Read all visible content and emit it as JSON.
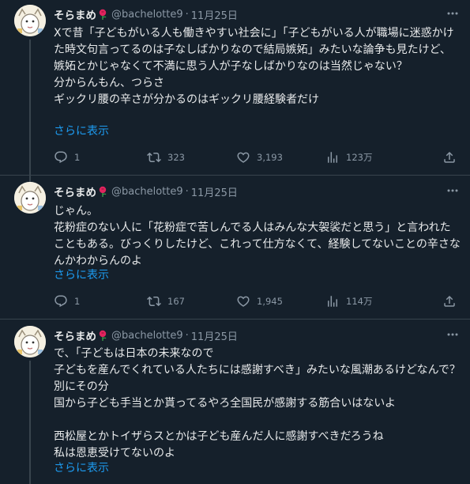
{
  "tweets": [
    {
      "name": "そらまめ",
      "handle": "@bachelotte9",
      "dot": "·",
      "date": "11月25日",
      "text": "Xで昔「子どもがいる人も働きやすい社会に」「子どもがいる人が職場に迷惑かけた時文句言ってるのは子なしばかりなので結局嫉妬」みたいな論争も見たけど、\n嫉妬とかじゃなくて不満に思う人が子なしばかりなのは当然じゃない？\n分からんもん、つらさ\nギックリ腰の辛さが分かるのはギックリ腰経験者だけ",
      "show_more": "さらに表示",
      "replies": "1",
      "retweets": "323",
      "likes": "3,193",
      "views": "123万"
    },
    {
      "name": "そらまめ",
      "handle": "@bachelotte9",
      "dot": "·",
      "date": "11月25日",
      "text": "じゃん。\n花粉症のない人に「花粉症で苦しんでる人はみんな大袈裟だと思う」と言われたこともある。びっくりしたけど、これって仕方なくて、経験してないことの辛さなんかわからんのよ",
      "show_more": "さらに表示",
      "replies": "1",
      "retweets": "167",
      "likes": "1,945",
      "views": "114万"
    },
    {
      "name": "そらまめ",
      "handle": "@bachelotte9",
      "dot": "·",
      "date": "11月25日",
      "text": "で、「子どもは日本の未来なので\n子どもを産んでくれている人たちには感謝すべき」みたいな風潮あるけどなんで？別にその分\n国から子ども手当とか貰ってるやろ全国民が感謝する筋合いはないよ\n\n西松屋とかトイザらスとかは子ども産んだ人に感謝すべきだろうね\n私は恩恵受けてないのよ",
      "show_more": "さらに表示"
    }
  ],
  "colors": {
    "background": "#15202b",
    "text": "#e7e9ea",
    "muted": "#8b98a5",
    "link": "#1d9bf0",
    "divider": "#38444d",
    "rose": "#e0245e"
  },
  "icons": {
    "reply": "reply-icon",
    "retweet": "retweet-icon",
    "like": "heart-icon",
    "views": "views-icon",
    "share": "share-icon",
    "more": "more-icon",
    "rose": "rose-emoji"
  }
}
